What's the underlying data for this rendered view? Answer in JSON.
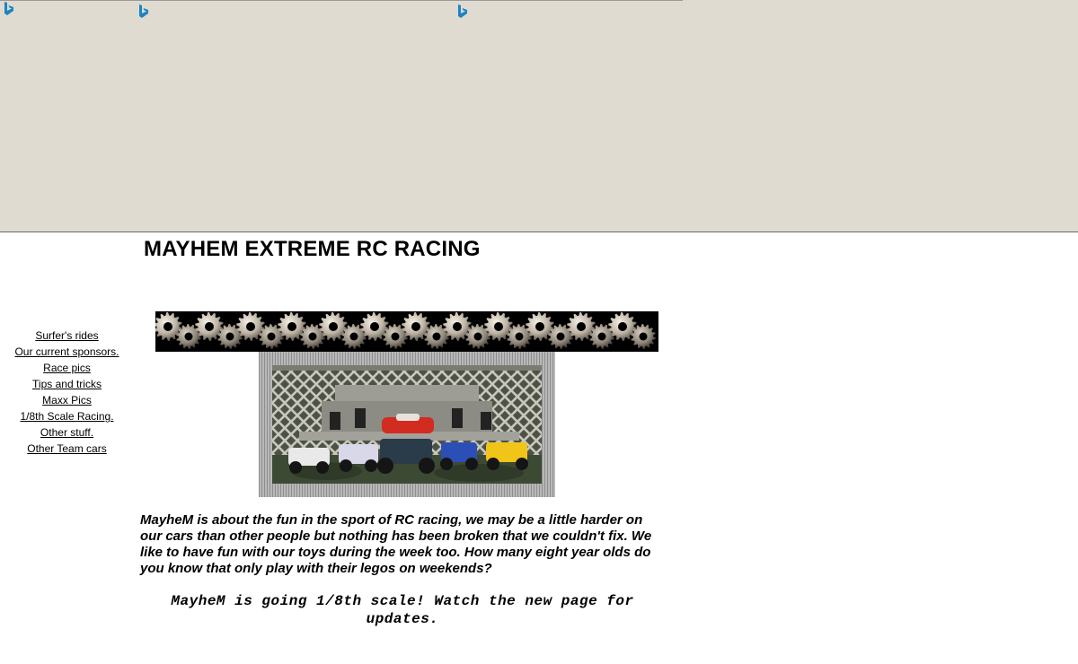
{
  "banner": {
    "icons": [
      "bing-icon",
      "bing-icon",
      "bing-icon"
    ]
  },
  "site": {
    "title": "MAYHEM EXTREME RC RACING"
  },
  "sidebar": {
    "items": [
      {
        "label": "Surfer's rides"
      },
      {
        "label": "Our current sponsors."
      },
      {
        "label": "Race pics"
      },
      {
        "label": "Tips and tricks"
      },
      {
        "label": "Maxx Pics"
      },
      {
        "label": "1/8th Scale Racing."
      },
      {
        "label": "Other stuff."
      },
      {
        "label": "Other Team cars"
      }
    ]
  },
  "main": {
    "gear_banner_icon": "gear-icon",
    "photo_icon": "rc-cars-photo",
    "intro": "MayheM is about the fun in the sport of RC racing, we may be a little harder on our cars than other people but nothing has been broken that we couldn't fix. We like to have fun with our toys during the week too. How many eight year olds do you know that only play with their legos on weekends?",
    "announcement": "MayheM is going 1/8th scale! Watch the new page for updates."
  },
  "colors": {
    "banner_bg": "#dfdbd0",
    "page_bg": "#ffffff",
    "icon_blue": "#1b84c4"
  }
}
